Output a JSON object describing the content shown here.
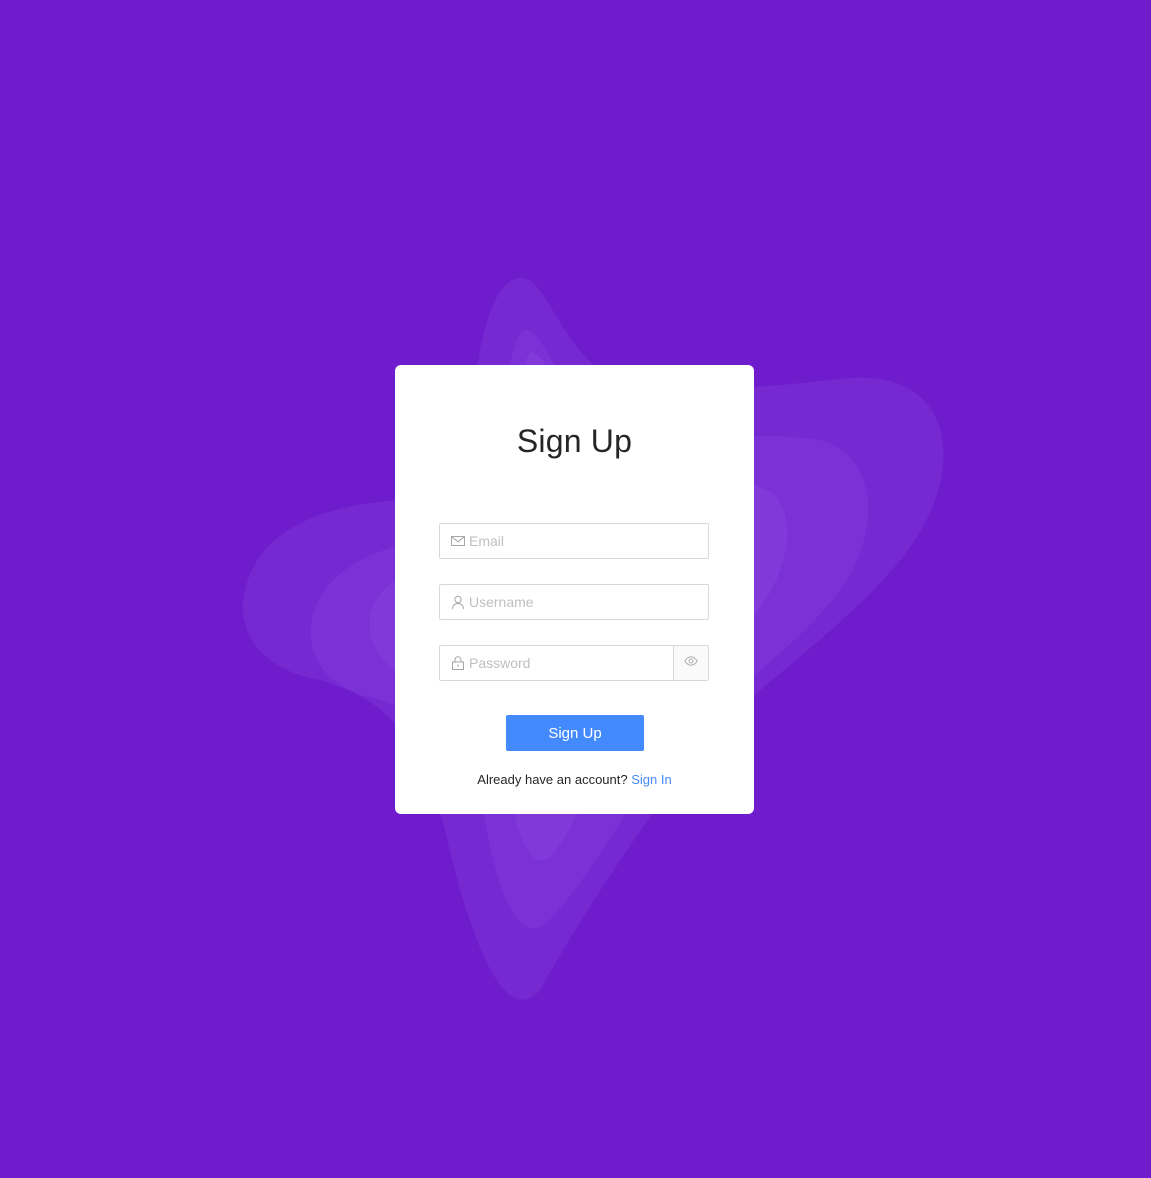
{
  "colors": {
    "background": "#6f1dcc",
    "card": "#ffffff",
    "primary_button": "#448aff",
    "link": "#448aff"
  },
  "form": {
    "title": "Sign Up",
    "email": {
      "placeholder": "Email",
      "value": "",
      "icon": "mail-icon"
    },
    "username": {
      "placeholder": "Username",
      "value": "",
      "icon": "user-icon"
    },
    "password": {
      "placeholder": "Password",
      "value": "",
      "icon": "lock-icon",
      "toggle_icon": "eye-icon"
    },
    "submit_label": "Sign Up",
    "footer": {
      "text": "Already have an account?",
      "link_label": "Sign In"
    }
  }
}
